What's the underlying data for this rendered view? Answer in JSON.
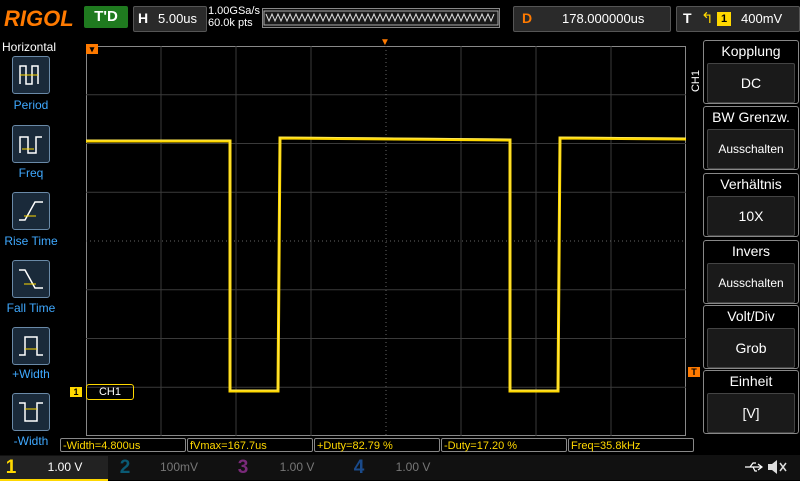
{
  "header": {
    "brand": "RIGOL",
    "trigger_status": "T'D",
    "horizontal": {
      "key": "H",
      "value": "5.00us"
    },
    "sample_rate": "1.00GSa/s",
    "memory_depth": "60.0k pts",
    "delay": {
      "key": "D",
      "value": "178.000000us"
    },
    "trigger": {
      "key": "T",
      "edge": "rising-edge-icon",
      "source": "1",
      "level": "400mV"
    }
  },
  "left_menu": {
    "title": "Horizontal",
    "items": [
      {
        "label": "Period",
        "icon": "period-icon"
      },
      {
        "label": "Freq",
        "icon": "frequency-icon"
      },
      {
        "label": "Rise Time",
        "icon": "rise-time-icon"
      },
      {
        "label": "Fall Time",
        "icon": "fall-time-icon"
      },
      {
        "label": "+Width",
        "icon": "positive-width-icon"
      },
      {
        "label": "-Width",
        "icon": "negative-width-icon"
      }
    ]
  },
  "right_menu": {
    "channel_tag": "CH1",
    "items": [
      {
        "title": "Kopplung",
        "value": "DC"
      },
      {
        "title": "BW Grenzw.",
        "value": "Ausschalten"
      },
      {
        "title": "Verhältnis",
        "value": "10X"
      },
      {
        "title": "Invers",
        "value": "Ausschalten"
      },
      {
        "title": "Volt/Div",
        "value": "Grob"
      },
      {
        "title": "Einheit",
        "value": "[V]"
      }
    ]
  },
  "waveform": {
    "channel_label": "CH1",
    "color": "#ffd800",
    "trigger_marker": "T",
    "ground_marker": "1"
  },
  "measurements": [
    {
      "label": "-Width=4.800us"
    },
    {
      "label": "fVmax=167.7us"
    },
    {
      "label": "+Duty=82.79 %"
    },
    {
      "label": "-Duty=17.20 %"
    },
    {
      "label": "Freq=35.8kHz"
    }
  ],
  "channels": [
    {
      "num": "1",
      "scale": "1.00 V",
      "color": "#ffd800",
      "active": true
    },
    {
      "num": "2",
      "scale": "100mV",
      "color": "#00c8ff",
      "active": false
    },
    {
      "num": "3",
      "scale": "1.00 V",
      "color": "#ff40ff",
      "active": false
    },
    {
      "num": "4",
      "scale": "1.00 V",
      "color": "#3a8cff",
      "active": false
    }
  ],
  "status_icons": [
    "usb-icon",
    "speaker-icon"
  ]
}
